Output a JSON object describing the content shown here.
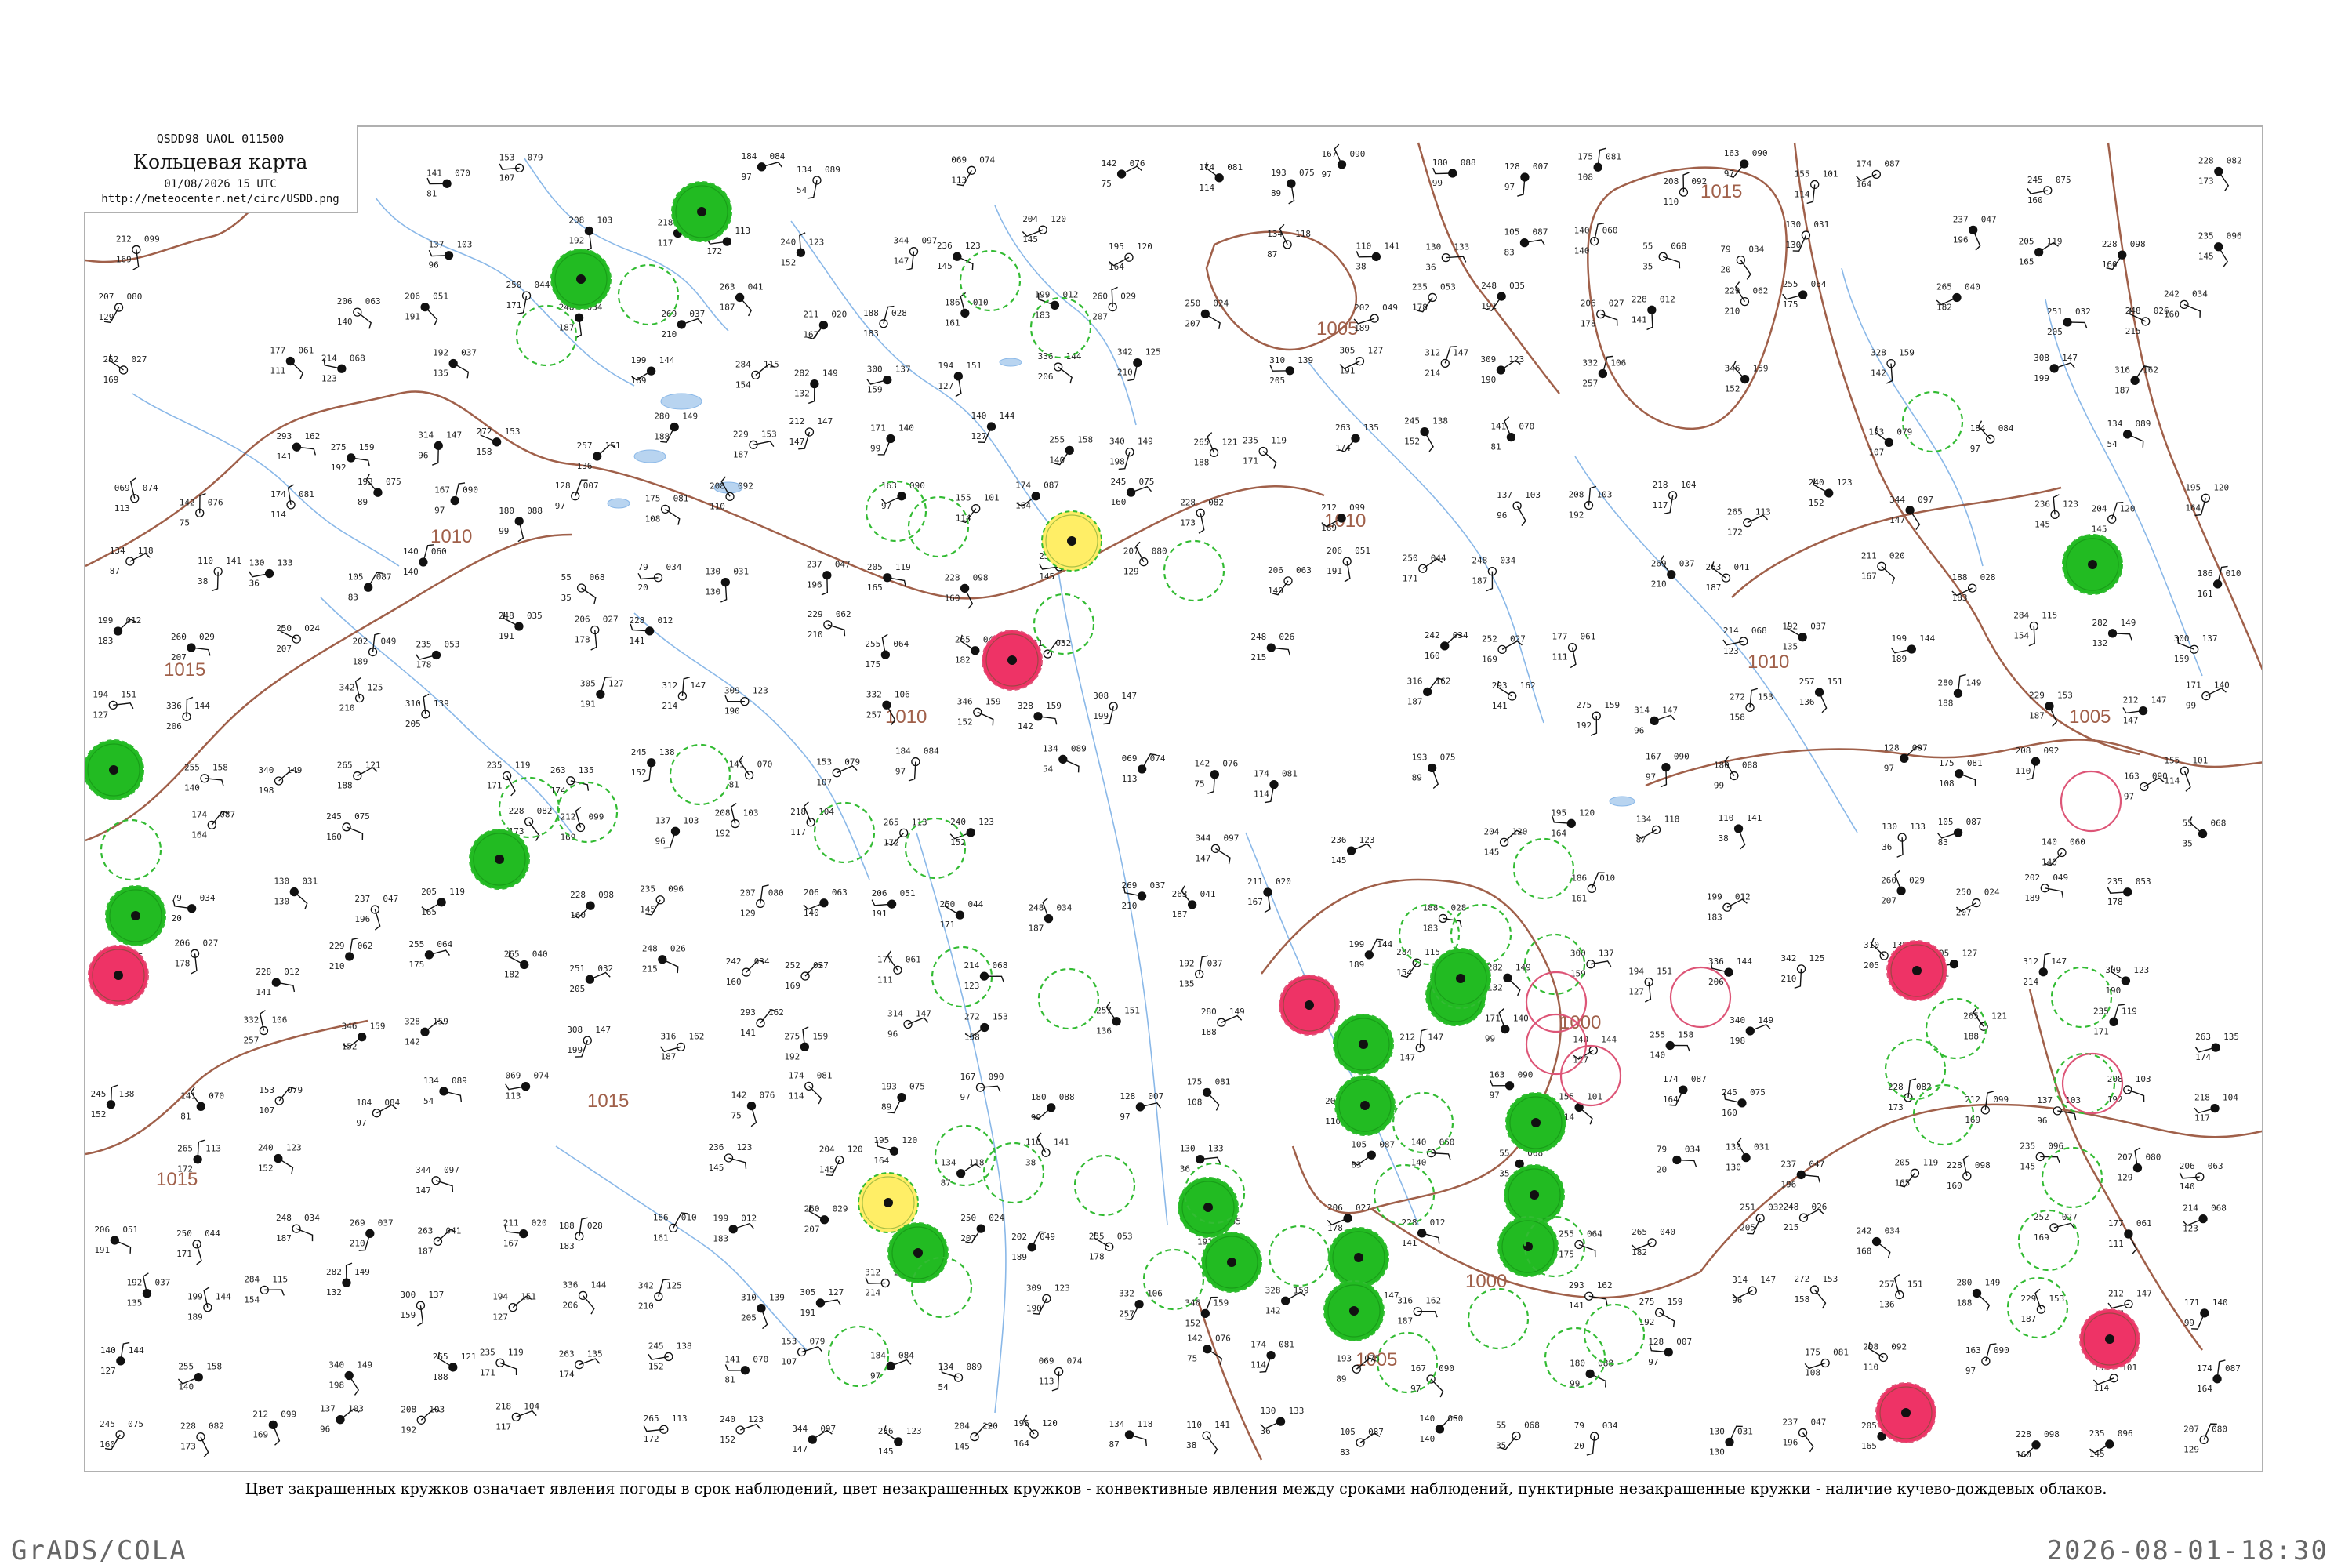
{
  "header": {
    "code_line": "QSDD98  UAOL  011500",
    "title": "Кольцевая карта",
    "datetime": "01/08/2026 15 UTC",
    "url": "http://meteocenter.net/circ/USDD.png"
  },
  "caption": "Цвет закрашенных кружков означает явления погоды в срок наблюдений, цвет незакрашенных кружков - конвективные явления между сроками наблюдений, пунктирные незакрашенные кружки - наличие кучево-дождевых облаков.",
  "footer": {
    "left": "GrADS/COLA",
    "right": "2026-08-01-18:30"
  },
  "colors": {
    "isobar": "#a0604a",
    "river": "#8ab8e8",
    "rain": "#22bb22",
    "thunder": "#ee3366",
    "shower": "#ffee66",
    "cb_ring": "#33bb33",
    "thunder_ring": "#dd5577"
  },
  "isobar_labels": [
    "005",
    "1010",
    "1015",
    "1005",
    "1015",
    "1010",
    "1010",
    "1015",
    "1015",
    "1000",
    "1000",
    "1005",
    "1005",
    "1010"
  ],
  "station_readings": [
    {
      "temp": "141",
      "pres": "070",
      "dew": "81"
    },
    {
      "temp": "153",
      "pres": "079",
      "dew": "107"
    },
    {
      "temp": "184",
      "pres": "084",
      "dew": "97"
    },
    {
      "temp": "134",
      "pres": "089",
      "dew": "54"
    },
    {
      "temp": "069",
      "pres": "074",
      "dew": "113"
    },
    {
      "temp": "142",
      "pres": "076",
      "dew": "75"
    },
    {
      "temp": "174",
      "pres": "081",
      "dew": "114"
    },
    {
      "temp": "193",
      "pres": "075",
      "dew": "89"
    },
    {
      "temp": "167",
      "pres": "090",
      "dew": "97"
    },
    {
      "temp": "180",
      "pres": "088",
      "dew": "99"
    },
    {
      "temp": "128",
      "pres": "007",
      "dew": "97"
    },
    {
      "temp": "175",
      "pres": "081",
      "dew": "108"
    },
    {
      "temp": "208",
      "pres": "092",
      "dew": "110"
    },
    {
      "temp": "163",
      "pres": "090",
      "dew": "97"
    },
    {
      "temp": "155",
      "pres": "101",
      "dew": "114"
    },
    {
      "temp": "174",
      "pres": "087",
      "dew": "164"
    },
    {
      "temp": "245",
      "pres": "075",
      "dew": "160"
    },
    {
      "temp": "228",
      "pres": "082",
      "dew": "173"
    },
    {
      "temp": "212",
      "pres": "099",
      "dew": "169"
    },
    {
      "temp": "137",
      "pres": "103",
      "dew": "96"
    },
    {
      "temp": "208",
      "pres": "103",
      "dew": "192"
    },
    {
      "temp": "218",
      "pres": "104",
      "dew": "117"
    },
    {
      "temp": "265",
      "pres": "113",
      "dew": "172"
    },
    {
      "temp": "240",
      "pres": "123",
      "dew": "152"
    },
    {
      "temp": "344",
      "pres": "097",
      "dew": "147"
    },
    {
      "temp": "236",
      "pres": "123",
      "dew": "145"
    },
    {
      "temp": "204",
      "pres": "120",
      "dew": "145"
    },
    {
      "temp": "195",
      "pres": "120",
      "dew": "164"
    },
    {
      "temp": "134",
      "pres": "118",
      "dew": "87"
    },
    {
      "temp": "110",
      "pres": "141",
      "dew": "38"
    },
    {
      "temp": "130",
      "pres": "133",
      "dew": "36"
    },
    {
      "temp": "105",
      "pres": "087",
      "dew": "83"
    },
    {
      "temp": "140",
      "pres": "060",
      "dew": "140"
    },
    {
      "temp": "55",
      "pres": "068",
      "dew": "35"
    },
    {
      "temp": "79",
      "pres": "034",
      "dew": "20"
    },
    {
      "temp": "130",
      "pres": "031",
      "dew": "130"
    },
    {
      "temp": "237",
      "pres": "047",
      "dew": "196"
    },
    {
      "temp": "205",
      "pres": "119",
      "dew": "165"
    },
    {
      "temp": "228",
      "pres": "098",
      "dew": "160"
    },
    {
      "temp": "235",
      "pres": "096",
      "dew": "145"
    },
    {
      "temp": "207",
      "pres": "080",
      "dew": "129"
    },
    {
      "temp": "206",
      "pres": "063",
      "dew": "140"
    },
    {
      "temp": "206",
      "pres": "051",
      "dew": "191"
    },
    {
      "temp": "250",
      "pres": "044",
      "dew": "171"
    },
    {
      "temp": "248",
      "pres": "034",
      "dew": "187"
    },
    {
      "temp": "269",
      "pres": "037",
      "dew": "210"
    },
    {
      "temp": "263",
      "pres": "041",
      "dew": "187"
    },
    {
      "temp": "211",
      "pres": "020",
      "dew": "167"
    },
    {
      "temp": "188",
      "pres": "028",
      "dew": "183"
    },
    {
      "temp": "186",
      "pres": "010",
      "dew": "161"
    },
    {
      "temp": "199",
      "pres": "012",
      "dew": "183"
    },
    {
      "temp": "260",
      "pres": "029",
      "dew": "207"
    },
    {
      "temp": "250",
      "pres": "024",
      "dew": "207"
    },
    {
      "temp": "202",
      "pres": "049",
      "dew": "189"
    },
    {
      "temp": "235",
      "pres": "053",
      "dew": "178"
    },
    {
      "temp": "248",
      "pres": "035",
      "dew": "191"
    },
    {
      "temp": "206",
      "pres": "027",
      "dew": "178"
    },
    {
      "temp": "228",
      "pres": "012",
      "dew": "141"
    },
    {
      "temp": "229",
      "pres": "062",
      "dew": "210"
    },
    {
      "temp": "255",
      "pres": "064",
      "dew": "175"
    },
    {
      "temp": "265",
      "pres": "040",
      "dew": "182"
    },
    {
      "temp": "251",
      "pres": "032",
      "dew": "205"
    },
    {
      "temp": "248",
      "pres": "026",
      "dew": "215"
    },
    {
      "temp": "242",
      "pres": "034",
      "dew": "160"
    },
    {
      "temp": "252",
      "pres": "027",
      "dew": "169"
    },
    {
      "temp": "177",
      "pres": "061",
      "dew": "111"
    },
    {
      "temp": "214",
      "pres": "068",
      "dew": "123"
    },
    {
      "temp": "192",
      "pres": "037",
      "dew": "135"
    },
    {
      "temp": "199",
      "pres": "144",
      "dew": "189"
    },
    {
      "temp": "284",
      "pres": "115",
      "dew": "154"
    },
    {
      "temp": "282",
      "pres": "149",
      "dew": "132"
    },
    {
      "temp": "300",
      "pres": "137",
      "dew": "159"
    },
    {
      "temp": "194",
      "pres": "151",
      "dew": "127"
    },
    {
      "temp": "336",
      "pres": "144",
      "dew": "206"
    },
    {
      "temp": "342",
      "pres": "125",
      "dew": "210"
    },
    {
      "temp": "310",
      "pres": "139",
      "dew": "205"
    },
    {
      "temp": "305",
      "pres": "127",
      "dew": "191"
    },
    {
      "temp": "312",
      "pres": "147",
      "dew": "214"
    },
    {
      "temp": "309",
      "pres": "123",
      "dew": "190"
    },
    {
      "temp": "332",
      "pres": "106",
      "dew": "257"
    },
    {
      "temp": "346",
      "pres": "159",
      "dew": "152"
    },
    {
      "temp": "328",
      "pres": "159",
      "dew": "142"
    },
    {
      "temp": "308",
      "pres": "147",
      "dew": "199"
    },
    {
      "temp": "316",
      "pres": "162",
      "dew": "187"
    },
    {
      "temp": "293",
      "pres": "162",
      "dew": "141"
    },
    {
      "temp": "275",
      "pres": "159",
      "dew": "192"
    },
    {
      "temp": "314",
      "pres": "147",
      "dew": "96"
    },
    {
      "temp": "272",
      "pres": "153",
      "dew": "158"
    },
    {
      "temp": "257",
      "pres": "151",
      "dew": "136"
    },
    {
      "temp": "280",
      "pres": "149",
      "dew": "188"
    },
    {
      "temp": "229",
      "pres": "153",
      "dew": "187"
    },
    {
      "temp": "212",
      "pres": "147",
      "dew": "147"
    },
    {
      "temp": "171",
      "pres": "140",
      "dew": "99"
    },
    {
      "temp": "140",
      "pres": "144",
      "dew": "127"
    },
    {
      "temp": "255",
      "pres": "158",
      "dew": "140"
    },
    {
      "temp": "340",
      "pres": "149",
      "dew": "198"
    },
    {
      "temp": "265",
      "pres": "121",
      "dew": "188"
    },
    {
      "temp": "235",
      "pres": "119",
      "dew": "171"
    },
    {
      "temp": "263",
      "pres": "135",
      "dew": "174"
    },
    {
      "temp": "245",
      "pres": "138",
      "dew": "152"
    }
  ]
}
